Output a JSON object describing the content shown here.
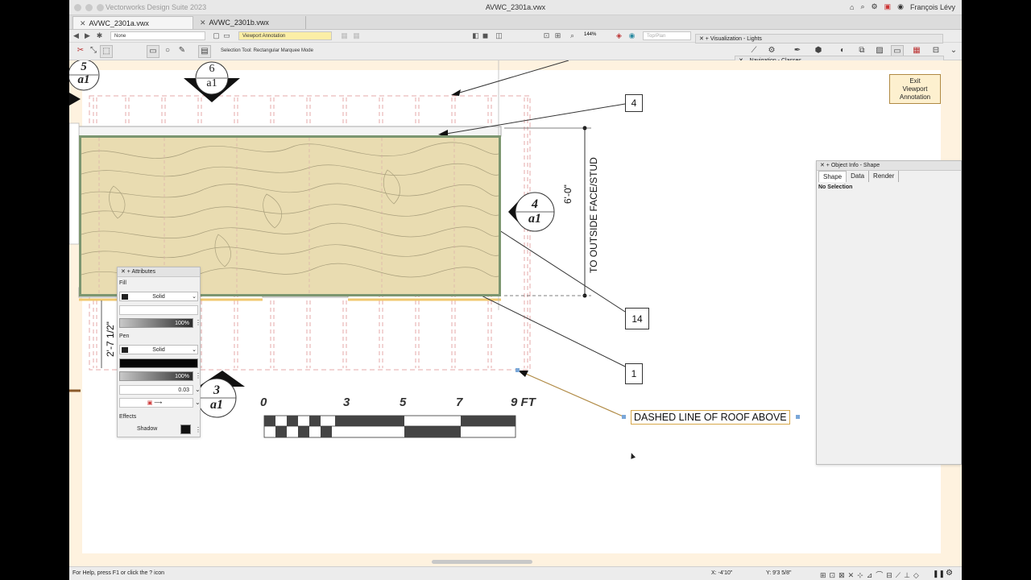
{
  "app": {
    "suite_name": "Vectorworks Design Suite 2023",
    "document_title": "AVWC_2301a.vwx",
    "user_name": "François Lévy"
  },
  "tabs": [
    {
      "label": "AVWC_2301a.vwx",
      "active": true
    },
    {
      "label": "AVWC_2301b.vwx",
      "active": false
    }
  ],
  "toolbar": {
    "class_value": "None",
    "layer_value": "Viewport Annotation",
    "zoom_value": "144%",
    "view_value": "Top/Plan",
    "mode_text": "Selection Tool: Rectangular Marquee Mode"
  },
  "floating_palettes": {
    "visualization": "Visualization - Lights",
    "navigation": "Navigation - Classes"
  },
  "canvas": {
    "exit_button": "Exit\nViewport\nAnnotation",
    "callouts": [
      "4",
      "14",
      "1"
    ],
    "note": "DASHED LINE OF ROOF ABOVE",
    "dim_vertical": "6'-0\"",
    "dim_vertical_note": "TO OUTSIDE FACE/STUD",
    "dim_left": "2'-7 1/2\"",
    "section_marks": [
      {
        "num": "5",
        "sheet": "a1"
      },
      {
        "num": "6",
        "sheet": "a1"
      },
      {
        "num": "4",
        "sheet": "a1"
      },
      {
        "num": "3",
        "sheet": "a1"
      }
    ],
    "scale_labels": [
      "0",
      "3",
      "5",
      "7",
      "9 FT"
    ]
  },
  "attributes_palette": {
    "title": "Attributes",
    "fill_label": "Fill",
    "fill_style": "Solid",
    "fill_opacity": "100%",
    "pen_label": "Pen",
    "pen_style": "Solid",
    "pen_opacity": "100%",
    "line_weight": "0.03",
    "effects_label": "Effects",
    "shadow_label": "Shadow"
  },
  "object_info": {
    "title": "Object Info - Shape",
    "tabs": [
      "Shape",
      "Data",
      "Render"
    ],
    "selection_text": "No Selection"
  },
  "status": {
    "help_text": "For Help, press F1 or click the ? icon",
    "x_coord": "X: -4'10\"",
    "y_coord": "Y: 9'3 5/8\""
  },
  "colors": {
    "floor_fill": "#e9dcb1",
    "sheet_border": "#fef2df",
    "wall_outline": "#7c9670",
    "note_border": "#d6a74a"
  }
}
